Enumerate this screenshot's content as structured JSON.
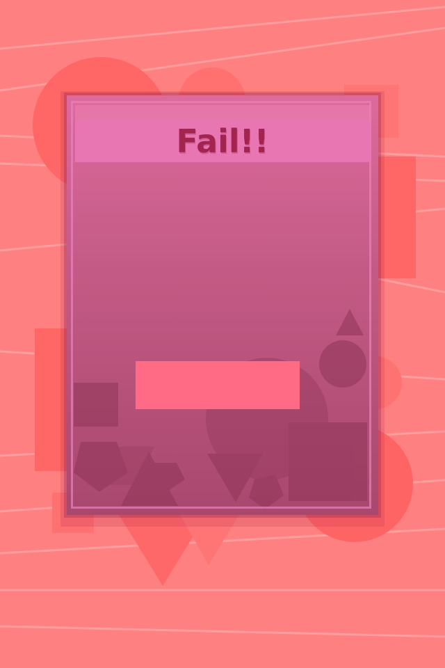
{
  "dialog": {
    "title": "Fail!!",
    "button_label": ""
  },
  "colors": {
    "background": "#ff8080",
    "panel_top": "#dd6a9c",
    "panel_bottom": "#a9486e",
    "title_band": "#e876b3",
    "title_text": "#a3244f",
    "button": "#ff6b85"
  }
}
